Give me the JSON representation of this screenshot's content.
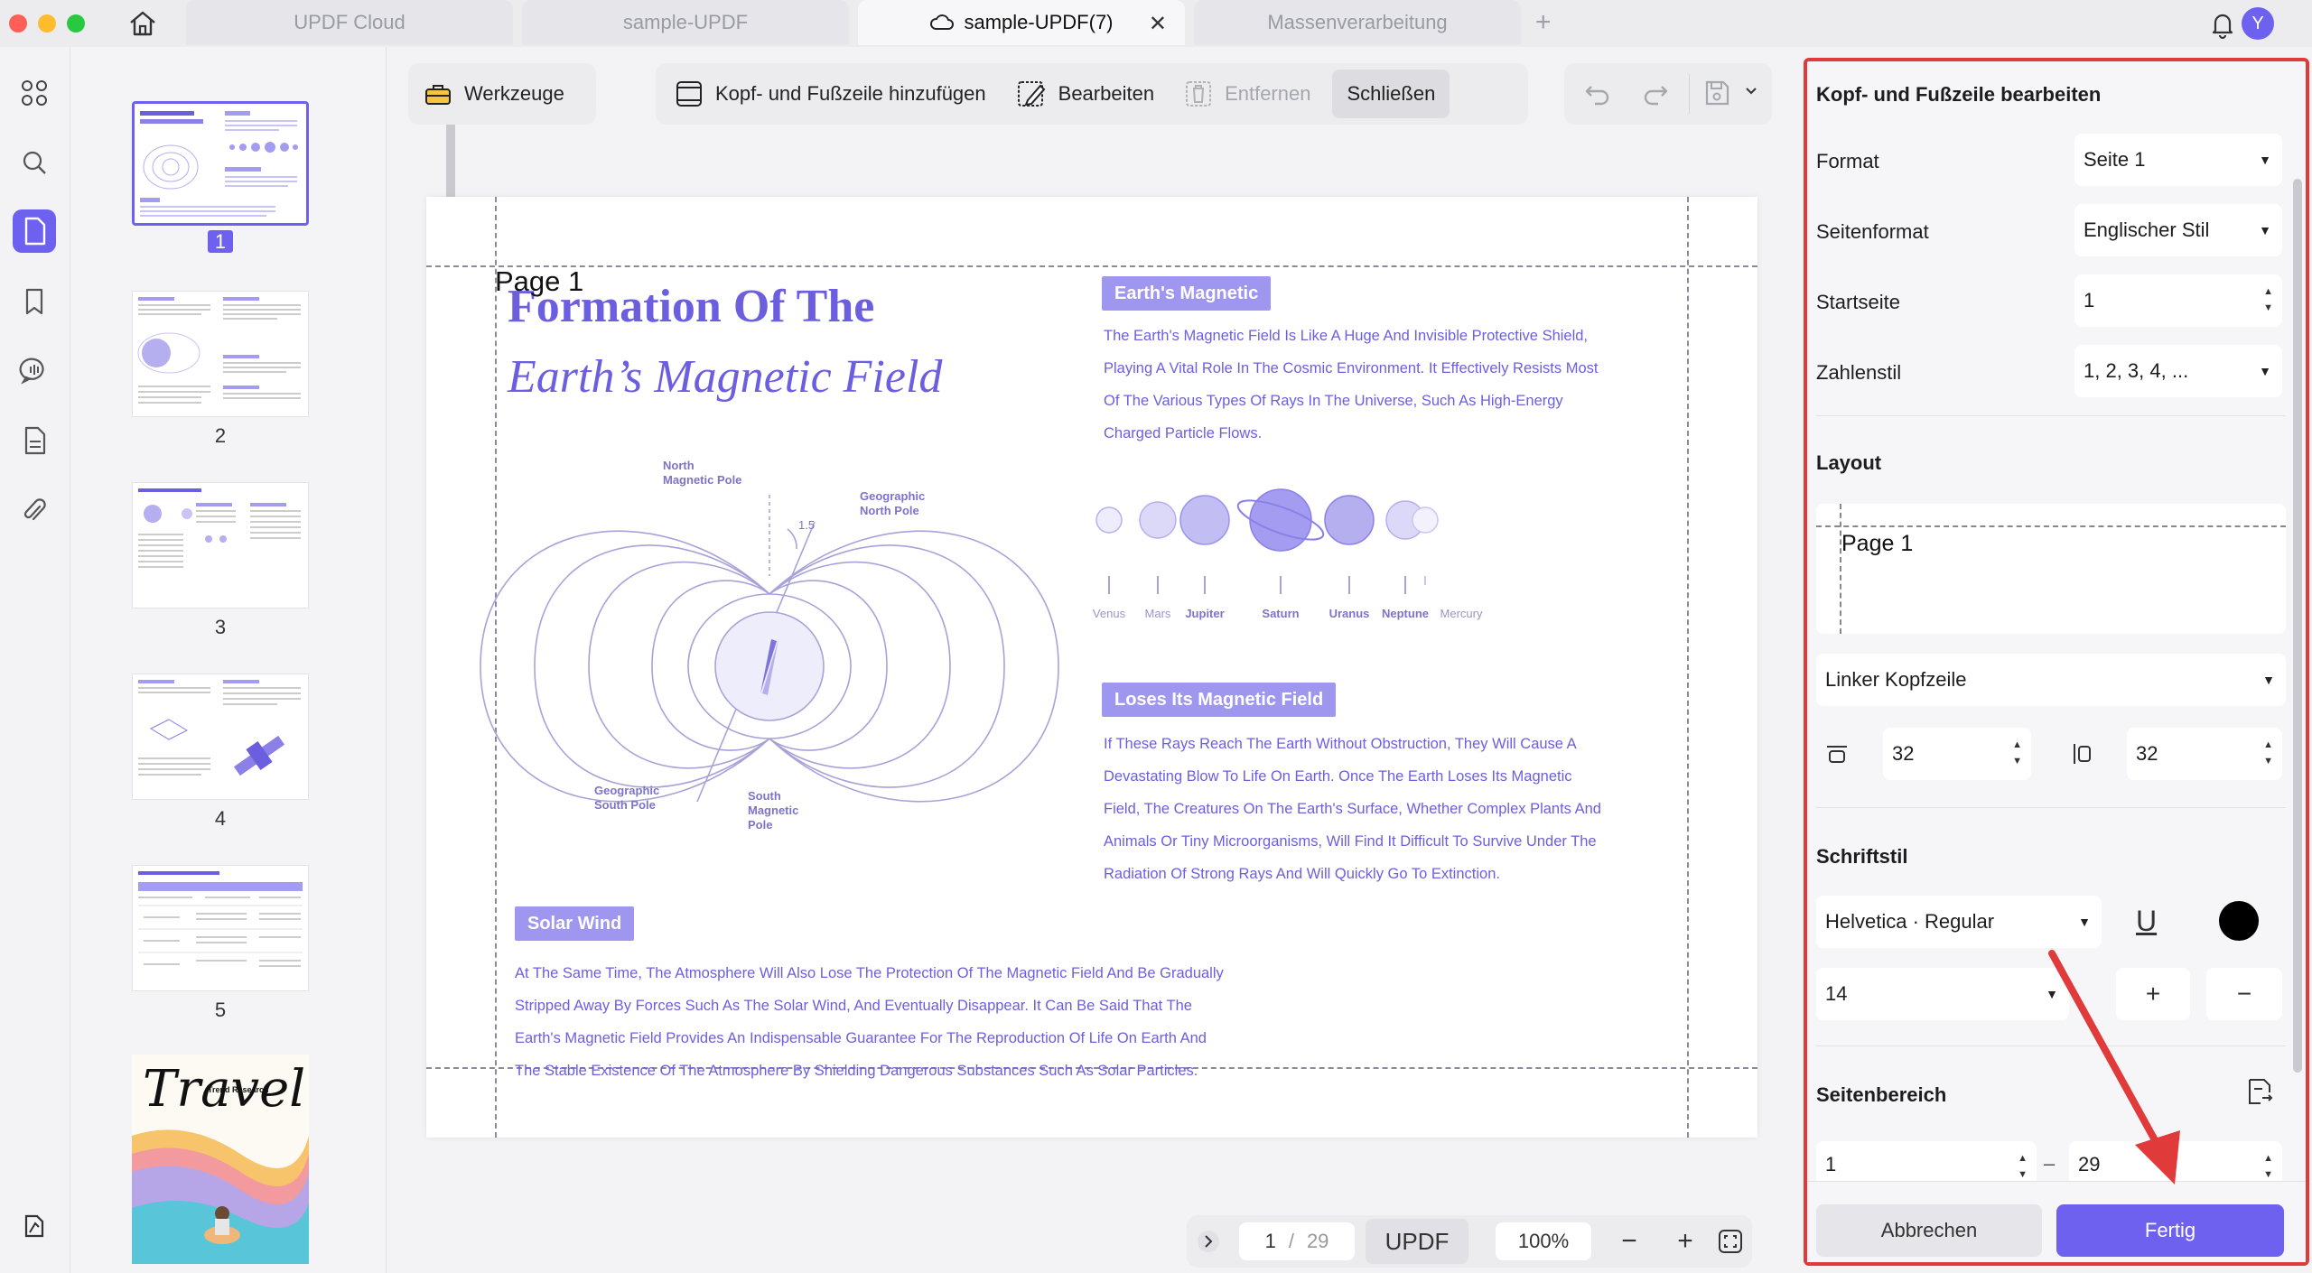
{
  "tabs": [
    {
      "label": "UPDF Cloud",
      "active": false
    },
    {
      "label": "sample-UPDF",
      "active": false
    },
    {
      "label": "sample-UPDF(7)",
      "active": true
    },
    {
      "label": "Massenverarbeitung",
      "active": false
    }
  ],
  "user_initial": "Y",
  "thumbnails": {
    "page_numbers": [
      "1",
      "2",
      "3",
      "4",
      "5"
    ],
    "selected": "1",
    "travel_title": "Travel",
    "travel_subtitle": "Trend Research"
  },
  "toolbar": {
    "tools_label": "Werkzeuge",
    "add_header_footer_label": "Kopf- und Fußzeile hinzufügen",
    "edit_label": "Bearbeiten",
    "remove_label": "Entfernen",
    "close_label": "Schließen"
  },
  "document": {
    "page_label": "Page 1",
    "title_line1": "Formation Of The",
    "title_line2": "Earth’s Magnetic Field",
    "section1_tag": "Earth's Magnetic",
    "section1_lines": [
      "The Earth's Magnetic Field Is Like A Huge And Invisible Protective Shield,",
      "Playing A Vital Role In The Cosmic Environment. It Effectively Resists Most",
      "Of The Various Types Of Rays In The Universe, Such As High-Energy",
      "Charged Particle Flows."
    ],
    "planets": [
      "Venus",
      "Mars",
      "Jupiter",
      "Saturn",
      "Uranus",
      "Neptune",
      "Mercury"
    ],
    "section2_tag": "Loses Its Magnetic Field",
    "section2_lines": [
      "If These Rays Reach The Earth Without Obstruction, They Will Cause A",
      "Devastating Blow To Life On Earth. Once The Earth Loses Its Magnetic",
      "Field, The Creatures On The Earth's Surface, Whether Complex Plants And",
      "Animals Or Tiny Microorganisms, Will Find It Difficult To Survive Under The",
      "Radiation Of Strong Rays And Will Quickly Go To Extinction."
    ],
    "section3_tag": "Solar Wind",
    "section3_lines": [
      "At The Same Time, The Atmosphere Will Also Lose The Protection Of The Magnetic Field And Be Gradually",
      "Stripped Away By Forces Such As The Solar Wind, And Eventually Disappear. It Can Be Said That The",
      "Earth's Magnetic Field Provides An Indispensable Guarantee For The Reproduction Of Life On Earth And",
      "The Stable Existence Of The Atmosphere By Shielding Dangerous Substances Such As Solar Particles."
    ],
    "diagram": {
      "north_magnetic_pole": [
        "North",
        "Magnetic Pole"
      ],
      "geographic_north_pole": [
        "Geographic",
        "North Pole"
      ],
      "geographic_south_pole": [
        "Geographic",
        "South Pole"
      ],
      "south_magnetic_pole": [
        "South",
        "Magnetic",
        "Pole"
      ],
      "angle": "1.5"
    }
  },
  "bottombar": {
    "current_page": "1",
    "separator": "/",
    "total_pages": "29",
    "brand": "UPDF",
    "zoom": "100%"
  },
  "panel": {
    "title": "Kopf- und Fußzeile bearbeiten",
    "format_label": "Format",
    "format_value": "Seite 1",
    "page_format_label": "Seitenformat",
    "page_format_value": "Englischer Stil",
    "start_page_label": "Startseite",
    "start_page_value": "1",
    "number_style_label": "Zahlenstil",
    "number_style_value": "1, 2, 3, 4, ...",
    "layout_heading": "Layout",
    "layout_preview_text": "Page 1",
    "position_value": "Linker Kopfzeile",
    "top_margin": "32",
    "side_margin": "32",
    "font_heading": "Schriftstil",
    "font_value": "Helvetica · Regular",
    "text_color": "#000000",
    "font_size": "14",
    "plus": "+",
    "minus": "−",
    "page_range_heading": "Seitenbereich",
    "range_from": "1",
    "range_dash": "–",
    "range_to": "29",
    "cancel_label": "Abbrechen",
    "done_label": "Fertig"
  },
  "colors": {
    "accent": "#6f61f0",
    "doc_text": "#6b5fe0",
    "highlight_border": "#e03a3a"
  }
}
